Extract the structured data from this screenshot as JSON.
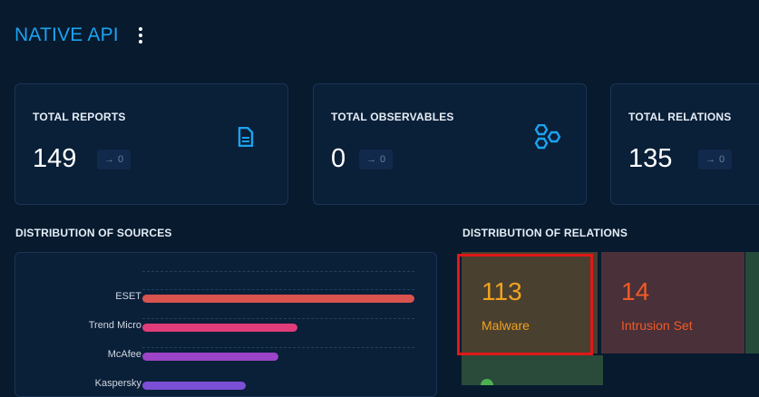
{
  "header": {
    "title": "NATIVE API"
  },
  "cards": [
    {
      "label": "TOTAL REPORTS",
      "value": "149",
      "delta": "0",
      "icon": "file-document-icon"
    },
    {
      "label": "TOTAL OBSERVABLES",
      "value": "0",
      "delta": "0",
      "icon": "hexagon-multiple-icon"
    },
    {
      "label": "TOTAL RELATIONS",
      "value": "135",
      "delta": "0",
      "icon": ""
    }
  ],
  "sources": {
    "title": "DISTRIBUTION OF SOURCES",
    "items": [
      {
        "name": "ESET",
        "value": 1.0,
        "color": "#d9534f"
      },
      {
        "name": "Trend Micro",
        "value": 0.57,
        "color": "#e03c7a"
      },
      {
        "name": "McAfee",
        "value": 0.5,
        "color": "#9b44c8"
      },
      {
        "name": "Kaspersky",
        "value": 0.38,
        "color": "#7b4fd6"
      }
    ]
  },
  "relations": {
    "title": "DISTRIBUTION OF RELATIONS",
    "tiles": [
      {
        "value": "113",
        "name": "Malware",
        "color": "#f0a320",
        "bg": "#4a4030"
      },
      {
        "value": "14",
        "name": "Intrusion Set",
        "color": "#f05a28",
        "bg": "#4a3038"
      },
      {
        "value": "",
        "name": "",
        "color": "#4caf50",
        "bg": "#254a3a"
      },
      {
        "value": "",
        "name": "",
        "color": "#4caf50",
        "bg": "#2a4a3a"
      }
    ]
  }
}
